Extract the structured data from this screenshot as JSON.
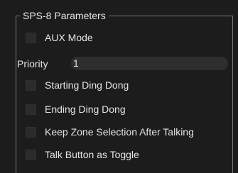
{
  "group": {
    "title": "SPS-8 Parameters"
  },
  "aux_mode": {
    "label": "AUX Mode",
    "checked": false
  },
  "priority": {
    "label": "Priority",
    "value": "1"
  },
  "starting_ding_dong": {
    "label": "Starting Ding Dong",
    "checked": false
  },
  "ending_ding_dong": {
    "label": "Ending Ding Dong",
    "checked": false
  },
  "keep_zone_selection": {
    "label": "Keep Zone Selection After Talking",
    "checked": false
  },
  "talk_button_toggle": {
    "label": "Talk Button as Toggle",
    "checked": false
  },
  "colors": {
    "background": "#1c1c1c",
    "frame": "#7a7a7a",
    "checkbox": "#2b2b2b",
    "input": "#2e2e2e",
    "text": "#e4e4e4"
  }
}
